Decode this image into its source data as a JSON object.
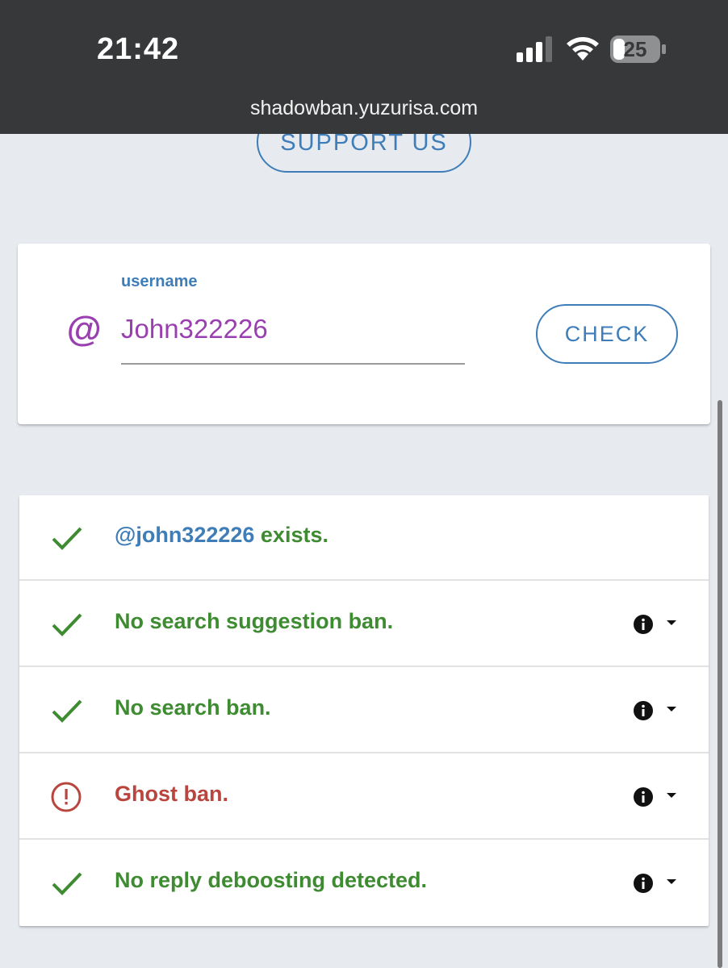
{
  "status_bar": {
    "time": "21:42",
    "battery_level": "25",
    "url": "shadowban.yuzurisa.com"
  },
  "support_button": {
    "label": "SUPPORT US"
  },
  "user_form": {
    "field_label": "username",
    "at_symbol": "@",
    "username_value": "John322226",
    "check_label": "CHECK"
  },
  "results": {
    "exists_handle": "@john322226",
    "exists_suffix": " exists.",
    "items": [
      {
        "text": "No search suggestion ban.",
        "status": "pass"
      },
      {
        "text": "No search ban.",
        "status": "pass"
      },
      {
        "text": "Ghost ban.",
        "status": "fail"
      },
      {
        "text": "No reply deboosting detected.",
        "status": "pass"
      }
    ]
  },
  "colors": {
    "success": "#3e8b32",
    "failure": "#b8453e",
    "accent": "#3f7db8",
    "username_purple": "#9a3fb0"
  },
  "icons": {
    "pass": "check-icon",
    "fail": "alert-circle-icon",
    "info": "info-icon",
    "dropdown": "caret-down-icon"
  }
}
